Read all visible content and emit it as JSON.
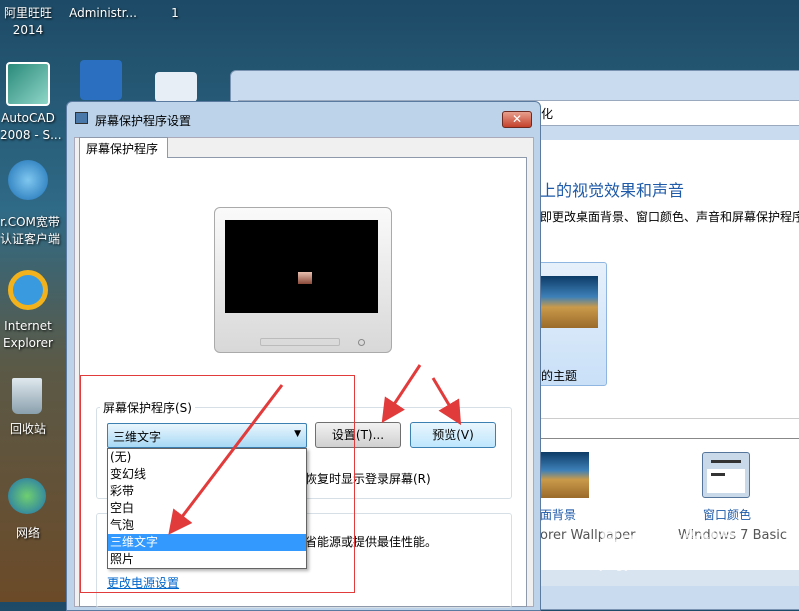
{
  "desktop": {
    "icons": [
      {
        "label": "阿里旺旺\n2014"
      },
      {
        "label": "Administr..."
      },
      {
        "label": "1"
      },
      {
        "label": "AutoCAD\n2008 - S..."
      },
      {
        "label": "r.COM宽带\n认证客户端"
      },
      {
        "label": "Internet\nExplorer"
      },
      {
        "label": "回收站"
      },
      {
        "label": "网络"
      }
    ]
  },
  "background_window": {
    "address_fragment": "化",
    "heading": "上的视觉效果和声音",
    "subtitle": "即更改桌面背景、窗口颜色、声音和屏幕保护程序",
    "theme_label": "的主题",
    "bottom_items": [
      {
        "title": "面背景",
        "subtitle": "orer Wallpaper"
      },
      {
        "title": "窗口颜色",
        "subtitle": "Windows 7 Basic"
      }
    ]
  },
  "dialog": {
    "title": "屏幕保护程序设置",
    "close": "✕",
    "tab": "屏幕保护程序",
    "group_label": "屏幕保护程序(S)",
    "selected": "三维文字",
    "settings_button": "设置(T)...",
    "preview_button": "预览(V)",
    "options": [
      "(无)",
      "变幻线",
      "彩带",
      "空白",
      "气泡",
      "三维文字",
      "照片"
    ],
    "selected_index": 5,
    "resume_checkbox": "恢复时显示登录屏幕(R)",
    "power_text": "省能源或提供最佳性能。",
    "power_link": "更改电源设置"
  },
  "watermark": {
    "brand": "Baidu经验",
    "url": "jingyan.baidu.com"
  },
  "colors": {
    "accent": "#3399ff",
    "annotation": "#e23b3b"
  }
}
